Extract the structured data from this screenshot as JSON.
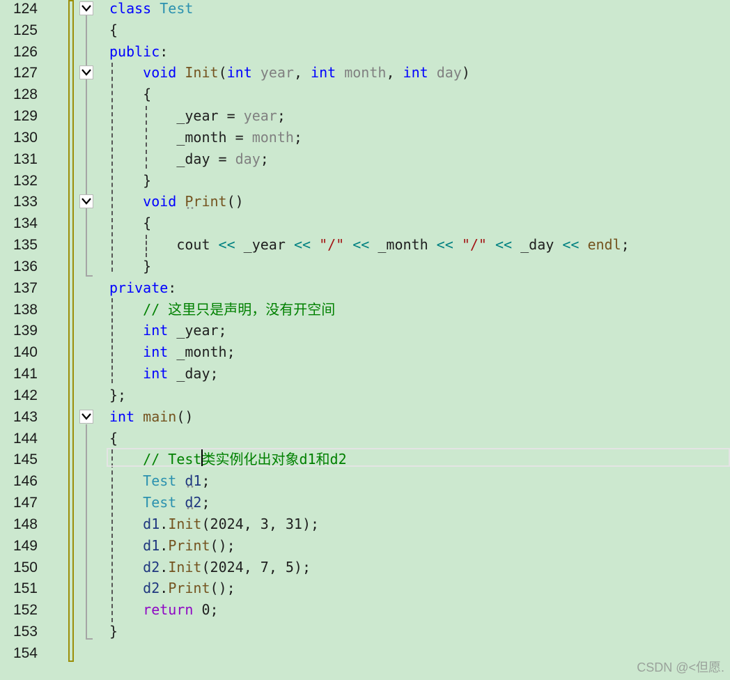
{
  "watermark": "CSDN @<但愿.",
  "lines": [
    {
      "n": "124",
      "fold": true,
      "tokens": [
        {
          "t": "class",
          "c": "kw"
        },
        {
          "t": " "
        },
        {
          "t": "Test",
          "c": "ty"
        }
      ]
    },
    {
      "n": "125",
      "tokens": [
        {
          "t": "{"
        }
      ]
    },
    {
      "n": "126",
      "tokens": [
        {
          "t": "public",
          "c": "kw"
        },
        {
          "t": ":"
        }
      ]
    },
    {
      "n": "127",
      "fold": true,
      "tokens": [
        {
          "t": "    "
        },
        {
          "t": "void",
          "c": "kw"
        },
        {
          "t": " "
        },
        {
          "t": "Init",
          "c": "fn"
        },
        {
          "t": "("
        },
        {
          "t": "int",
          "c": "kw"
        },
        {
          "t": " "
        },
        {
          "t": "year",
          "c": "pm"
        },
        {
          "t": ", "
        },
        {
          "t": "int",
          "c": "kw"
        },
        {
          "t": " "
        },
        {
          "t": "month",
          "c": "pm"
        },
        {
          "t": ", "
        },
        {
          "t": "int",
          "c": "kw"
        },
        {
          "t": " "
        },
        {
          "t": "day",
          "c": "pm"
        },
        {
          "t": ")"
        }
      ]
    },
    {
      "n": "128",
      "tokens": [
        {
          "t": "    {"
        }
      ]
    },
    {
      "n": "129",
      "tokens": [
        {
          "t": "        _year = "
        },
        {
          "t": "year",
          "c": "pm"
        },
        {
          "t": ";"
        }
      ]
    },
    {
      "n": "130",
      "tokens": [
        {
          "t": "        _month = "
        },
        {
          "t": "month",
          "c": "pm"
        },
        {
          "t": ";"
        }
      ]
    },
    {
      "n": "131",
      "tokens": [
        {
          "t": "        _day = "
        },
        {
          "t": "day",
          "c": "pm"
        },
        {
          "t": ";"
        }
      ]
    },
    {
      "n": "132",
      "tokens": [
        {
          "t": "    }"
        }
      ]
    },
    {
      "n": "133",
      "fold": true,
      "tokens": [
        {
          "t": "    "
        },
        {
          "t": "void",
          "c": "kw"
        },
        {
          "t": " "
        },
        {
          "t": "Print",
          "c": "fn"
        },
        {
          "t": "()"
        }
      ]
    },
    {
      "n": "134",
      "tokens": [
        {
          "t": "    {"
        }
      ]
    },
    {
      "n": "135",
      "tokens": [
        {
          "t": "        cout "
        },
        {
          "t": "<<",
          "c": "op"
        },
        {
          "t": " _year "
        },
        {
          "t": "<<",
          "c": "op"
        },
        {
          "t": " "
        },
        {
          "t": "\"/\"",
          "c": "str"
        },
        {
          "t": " "
        },
        {
          "t": "<<",
          "c": "op"
        },
        {
          "t": " _month "
        },
        {
          "t": "<<",
          "c": "op"
        },
        {
          "t": " "
        },
        {
          "t": "\"/\"",
          "c": "str"
        },
        {
          "t": " "
        },
        {
          "t": "<<",
          "c": "op"
        },
        {
          "t": " _day "
        },
        {
          "t": "<<",
          "c": "op"
        },
        {
          "t": " "
        },
        {
          "t": "endl",
          "c": "fn"
        },
        {
          "t": ";"
        }
      ]
    },
    {
      "n": "136",
      "tokens": [
        {
          "t": "    }"
        }
      ]
    },
    {
      "n": "137",
      "tokens": [
        {
          "t": "private",
          "c": "kw"
        },
        {
          "t": ":"
        }
      ]
    },
    {
      "n": "138",
      "tokens": [
        {
          "t": "    "
        },
        {
          "t": "// 这里只是声明，没有开空间",
          "c": "cm"
        }
      ]
    },
    {
      "n": "139",
      "tokens": [
        {
          "t": "    "
        },
        {
          "t": "int",
          "c": "kw"
        },
        {
          "t": " _year;"
        }
      ]
    },
    {
      "n": "140",
      "tokens": [
        {
          "t": "    "
        },
        {
          "t": "int",
          "c": "kw"
        },
        {
          "t": " _month;"
        }
      ]
    },
    {
      "n": "141",
      "tokens": [
        {
          "t": "    "
        },
        {
          "t": "int",
          "c": "kw"
        },
        {
          "t": " _day;"
        }
      ]
    },
    {
      "n": "142",
      "tokens": [
        {
          "t": "};"
        }
      ]
    },
    {
      "n": "143",
      "fold": true,
      "tokens": [
        {
          "t": "int",
          "c": "kw"
        },
        {
          "t": " "
        },
        {
          "t": "main",
          "c": "fn"
        },
        {
          "t": "()"
        }
      ]
    },
    {
      "n": "144",
      "tokens": [
        {
          "t": "{"
        }
      ]
    },
    {
      "n": "145",
      "tokens": [
        {
          "t": "    "
        },
        {
          "t": "// Test类实例化出对象d1和d2",
          "c": "cm"
        }
      ]
    },
    {
      "n": "146",
      "tokens": [
        {
          "t": "    "
        },
        {
          "t": "Test",
          "c": "ty"
        },
        {
          "t": " "
        },
        {
          "t": "d1",
          "c": "vr"
        },
        {
          "t": ";"
        }
      ]
    },
    {
      "n": "147",
      "tokens": [
        {
          "t": "    "
        },
        {
          "t": "Test",
          "c": "ty"
        },
        {
          "t": " "
        },
        {
          "t": "d2",
          "c": "vr"
        },
        {
          "t": ";"
        }
      ]
    },
    {
      "n": "148",
      "tokens": [
        {
          "t": "    "
        },
        {
          "t": "d1",
          "c": "vr"
        },
        {
          "t": "."
        },
        {
          "t": "Init",
          "c": "fn"
        },
        {
          "t": "(2024, 3, 31);"
        }
      ]
    },
    {
      "n": "149",
      "tokens": [
        {
          "t": "    "
        },
        {
          "t": "d1",
          "c": "vr"
        },
        {
          "t": "."
        },
        {
          "t": "Print",
          "c": "fn"
        },
        {
          "t": "();"
        }
      ]
    },
    {
      "n": "150",
      "tokens": [
        {
          "t": "    "
        },
        {
          "t": "d2",
          "c": "vr"
        },
        {
          "t": "."
        },
        {
          "t": "Init",
          "c": "fn"
        },
        {
          "t": "(2024, 7, 5);"
        }
      ]
    },
    {
      "n": "151",
      "tokens": [
        {
          "t": "    "
        },
        {
          "t": "d2",
          "c": "vr"
        },
        {
          "t": "."
        },
        {
          "t": "Print",
          "c": "fn"
        },
        {
          "t": "();"
        }
      ]
    },
    {
      "n": "152",
      "tokens": [
        {
          "t": "    "
        },
        {
          "t": "return",
          "c": "kw2"
        },
        {
          "t": " 0;"
        }
      ]
    },
    {
      "n": "153",
      "tokens": [
        {
          "t": "}"
        }
      ]
    },
    {
      "n": "154",
      "tokens": []
    }
  ]
}
